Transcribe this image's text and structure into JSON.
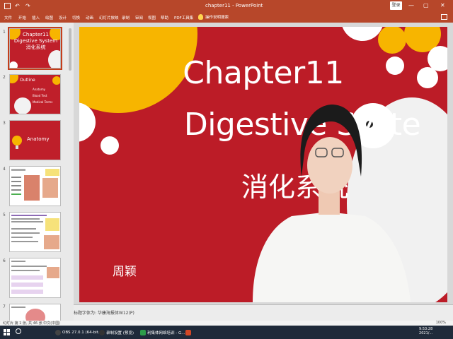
{
  "titlebar": {
    "doc_title": "chapter11  -  PowerPoint",
    "login_label": "登录",
    "minimize": "—",
    "restore": "▢",
    "close": "✕"
  },
  "ribbon": {
    "tabs": [
      "文件",
      "开始",
      "插入",
      "绘图",
      "设计",
      "切换",
      "动画",
      "幻灯片放映",
      "录制",
      "审阅",
      "视图",
      "帮助",
      "PDF工具集"
    ],
    "tell_me": "操作说明搜索"
  },
  "thumbnails": {
    "numbers": [
      "1",
      "2",
      "3",
      "4",
      "5",
      "6",
      "7"
    ],
    "slide1_lines": [
      "Chapter11",
      "Digestive System",
      "消化系统"
    ],
    "slide2_title": "Outline",
    "slide2_items": [
      "Anatomy",
      "Blood Test",
      "Medical Terms"
    ],
    "slide3_title": "Anatomy"
  },
  "slide": {
    "title_line1": "Chapter11",
    "title_line2": "Digestive Syste",
    "title_line3": "消化系统",
    "author": "周颖"
  },
  "notes": {
    "text": "标题字体为: 华康海报体W12(P)"
  },
  "statusbar": {
    "left": "幻灯片 第 1 张, 共 46 张    中文(中国)",
    "right": "100%"
  },
  "taskbar": {
    "items": [
      {
        "label": "OBS 27.0.1 (64-bit...",
        "color": "#444"
      },
      {
        "label": "录制设置 (预览)",
        "color": "#333"
      },
      {
        "label": "利集体网络培训 - G...",
        "color": "#2e9d4a"
      }
    ],
    "clock_time": "9:53:28",
    "clock_date": "2021/..."
  },
  "colors": {
    "powerpoint_red": "#b7472a",
    "slide_red": "#bc1c27",
    "accent_yellow": "#f7b500"
  }
}
